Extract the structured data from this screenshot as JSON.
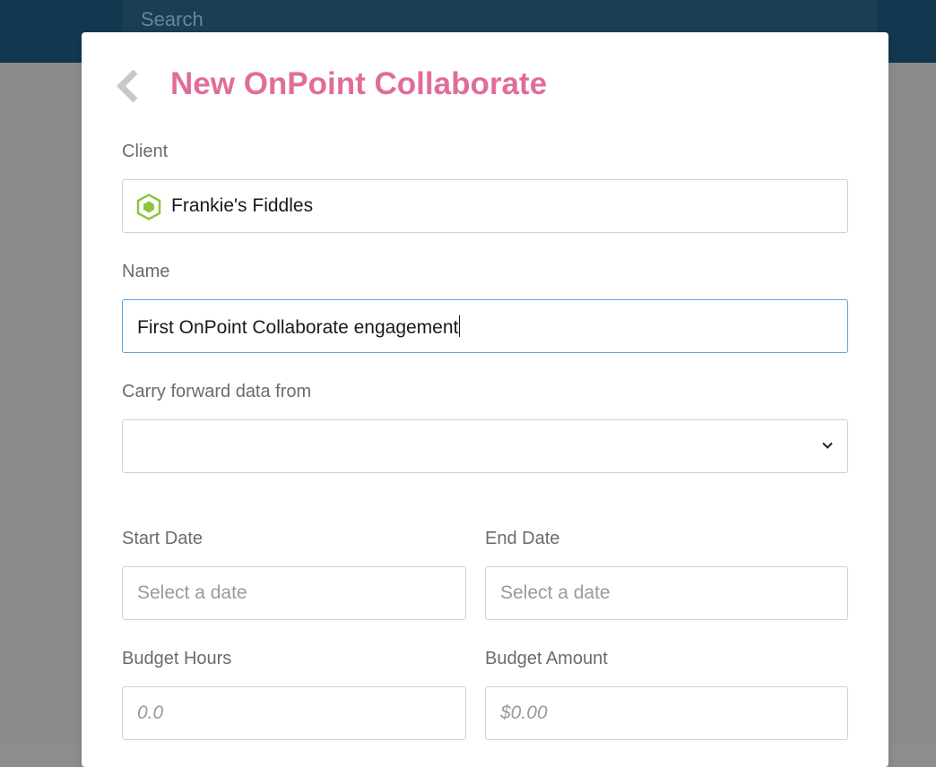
{
  "header": {
    "search_placeholder": "Search"
  },
  "modal": {
    "title": "New OnPoint Collaborate",
    "back_icon": "chevron-left-icon",
    "client": {
      "label": "Client",
      "value": "Frankie's Fiddles",
      "icon": "hexagon-client-icon",
      "icon_color": "#8cc63f"
    },
    "name": {
      "label": "Name",
      "value": "First OnPoint Collaborate engagement"
    },
    "carry_forward": {
      "label": "Carry forward data from",
      "value": "",
      "icon": "chevron-down-icon"
    },
    "start_date": {
      "label": "Start Date",
      "placeholder": "Select a date"
    },
    "end_date": {
      "label": "End Date",
      "placeholder": "Select a date"
    },
    "budget_hours": {
      "label": "Budget Hours",
      "placeholder": "0.0"
    },
    "budget_amount": {
      "label": "Budget Amount",
      "placeholder": "$0.00"
    }
  },
  "colors": {
    "title": "#e06d99",
    "header_bg": "#12384f",
    "focus_border": "#5aa3e0"
  }
}
